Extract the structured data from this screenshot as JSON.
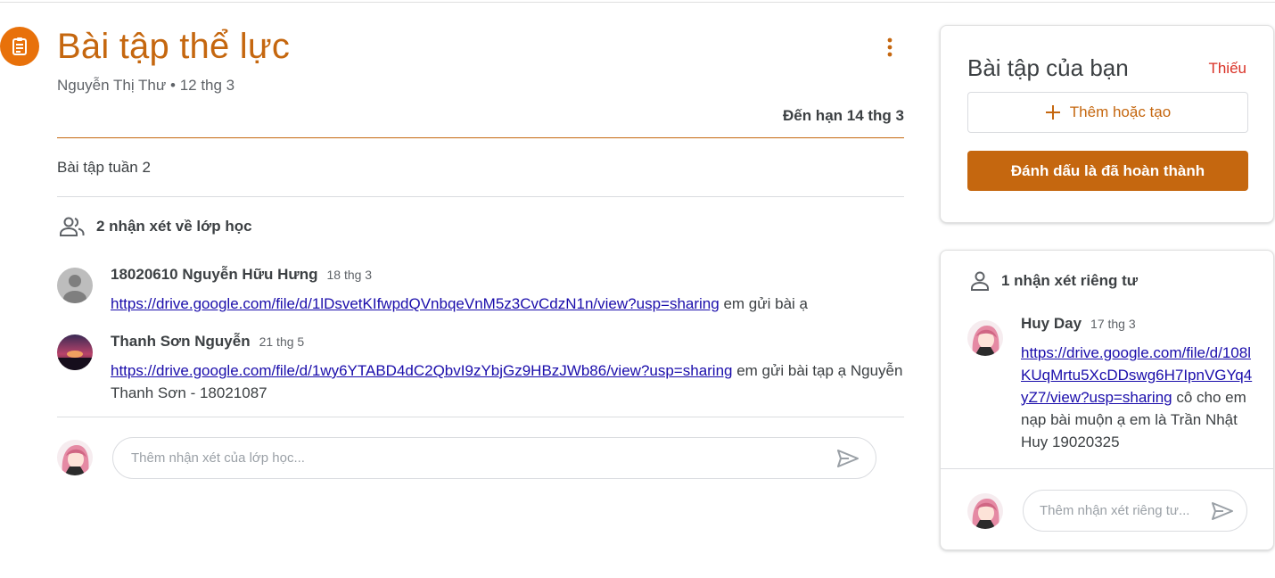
{
  "assignment": {
    "title": "Bài tập thể lực",
    "author": "Nguyễn Thị Thư",
    "separator": "•",
    "posted": "12 thg 3",
    "due": "Đến hạn 14 thg 3",
    "description": "Bài tập tuần 2"
  },
  "class_comments": {
    "header": "2 nhận xét về lớp học",
    "items": [
      {
        "name": "18020610 Nguyễn Hữu Hưng",
        "date": "18 thg 3",
        "link": "https://drive.google.com/file/d/1lDsvetKIfwpdQVnbqeVnM5z3CvCdzN1n/view?usp=sharing",
        "text": " em gửi bài ạ"
      },
      {
        "name": "Thanh Sơn Nguyễn",
        "date": "21 thg 5",
        "link": "https://drive.google.com/file/d/1wy6YTABD4dC2QbvI9zYbjGz9HBzJWb86/view?usp=sharing",
        "text": " em gửi bài tạp ạ Nguyễn Thanh Sơn - 18021087"
      }
    ],
    "input_placeholder": "Thêm nhận xét của lớp học..."
  },
  "your_work": {
    "title": "Bài tập của bạn",
    "status": "Thiếu",
    "add_label": "Thêm hoặc tạo",
    "mark_done_label": "Đánh dấu là đã hoàn thành"
  },
  "private_comments": {
    "header": "1 nhận xét riêng tư",
    "item": {
      "name": "Huy Day",
      "date": "17 thg 3",
      "link": "https://drive.google.com/file/d/108lKUqMrtu5XcDDswg6H7IpnVGYq4yZ7/view?usp=sharing",
      "text": "cô cho em nạp bài muộn ạ em là Trần Nhật Huy 19020325"
    },
    "input_placeholder": "Thêm nhận xét riêng tư..."
  },
  "colors": {
    "accent": "#c5670f",
    "icon_bg": "#e8710a",
    "missing": "#d93025",
    "link": "#1a0dab"
  }
}
